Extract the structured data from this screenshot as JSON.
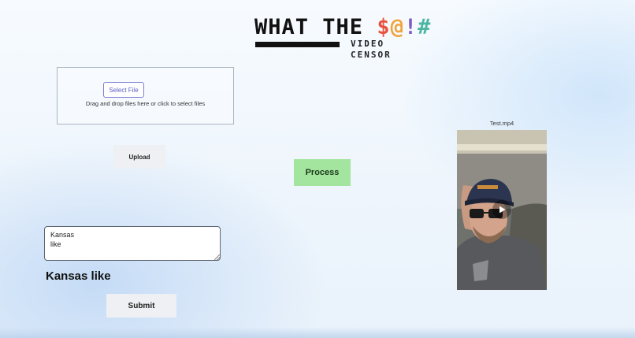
{
  "logo": {
    "title_prefix": "WHAT THE ",
    "symbols": [
      "$",
      "@",
      "!",
      "#"
    ],
    "subtitle_line1": "VIDEO",
    "subtitle_line2": "CENSOR"
  },
  "upload": {
    "select_label": "Select File",
    "drop_text": "Drag and drop files here or click to select files",
    "upload_label": "Upload"
  },
  "process": {
    "label": "Process"
  },
  "input": {
    "value": "Kansas\nlike"
  },
  "result": {
    "heading": "Kansas like"
  },
  "submit": {
    "label": "Submit"
  },
  "video": {
    "filename": "Test.mp4",
    "play_icon": "play-icon"
  },
  "colors": {
    "process_bg": "#a3e59f",
    "select_border": "#7b7fd6",
    "symbol_dollar": "#e8533f",
    "symbol_at": "#f2a33a",
    "symbol_bang": "#7c5cc4",
    "symbol_hash": "#4cb6a3"
  }
}
